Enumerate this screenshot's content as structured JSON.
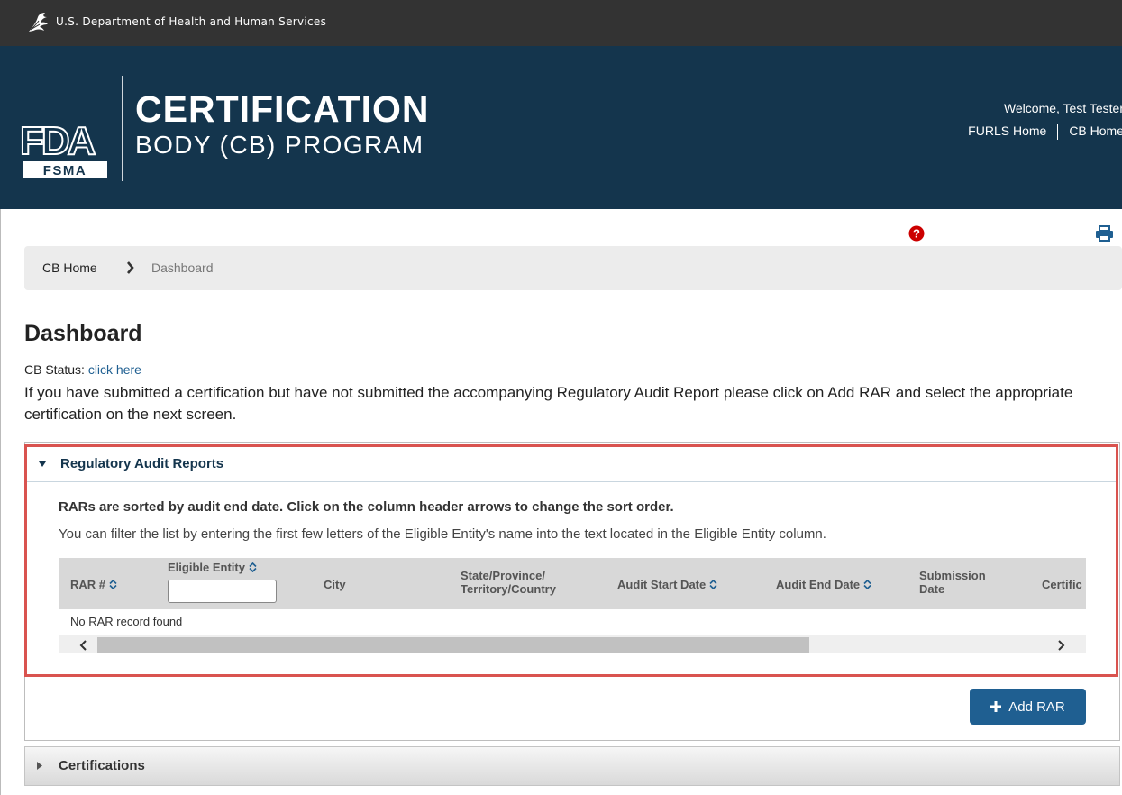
{
  "topbar": {
    "department": "U.S. Department of Health and Human Services"
  },
  "banner": {
    "logo_fda": "FDA",
    "logo_fsma": "FSMA",
    "title_line1": "CERTIFICATION",
    "title_line2": "BODY (CB) PROGRAM",
    "welcome": "Welcome, Test Tester",
    "links": [
      "FURLS Home",
      "CB Home"
    ]
  },
  "colors": {
    "banner": "#14354d",
    "topbar": "#333333",
    "accent": "#1f5f91",
    "highlight": "#d9534f",
    "help": "#cc0000"
  },
  "icons": {
    "help": "question-circle-icon",
    "print": "print-icon"
  },
  "breadcrumb": {
    "home": "CB Home",
    "current": "Dashboard"
  },
  "page": {
    "title": "Dashboard",
    "cb_status_label": "CB Status:",
    "cb_status_link": "click here",
    "intro": "If you have submitted a certification but have not submitted the accompanying Regulatory Audit Report please click on Add RAR and select the appropriate certification on the next screen."
  },
  "rar_panel": {
    "title": "Regulatory Audit Reports",
    "sort_note": "RARs are sorted by audit end date. Click on the column header arrows to change the sort order.",
    "filter_note": "You can filter the list by entering the first few letters of the Eligible Entity's name into the text located in the Eligible Entity column.",
    "columns": {
      "rar": "RAR #",
      "entity": "Eligible Entity",
      "city": "City",
      "state_1": "State/Province/",
      "state_2": "Territory/Country",
      "audit_start": "Audit Start Date",
      "audit_end": "Audit End Date",
      "submission_1": "Submission",
      "submission_2": "Date",
      "certificate": "Certific"
    },
    "filter_value": "",
    "empty_message": "No RAR record found",
    "add_button": "Add RAR"
  },
  "cert_panel": {
    "title": "Certifications"
  }
}
